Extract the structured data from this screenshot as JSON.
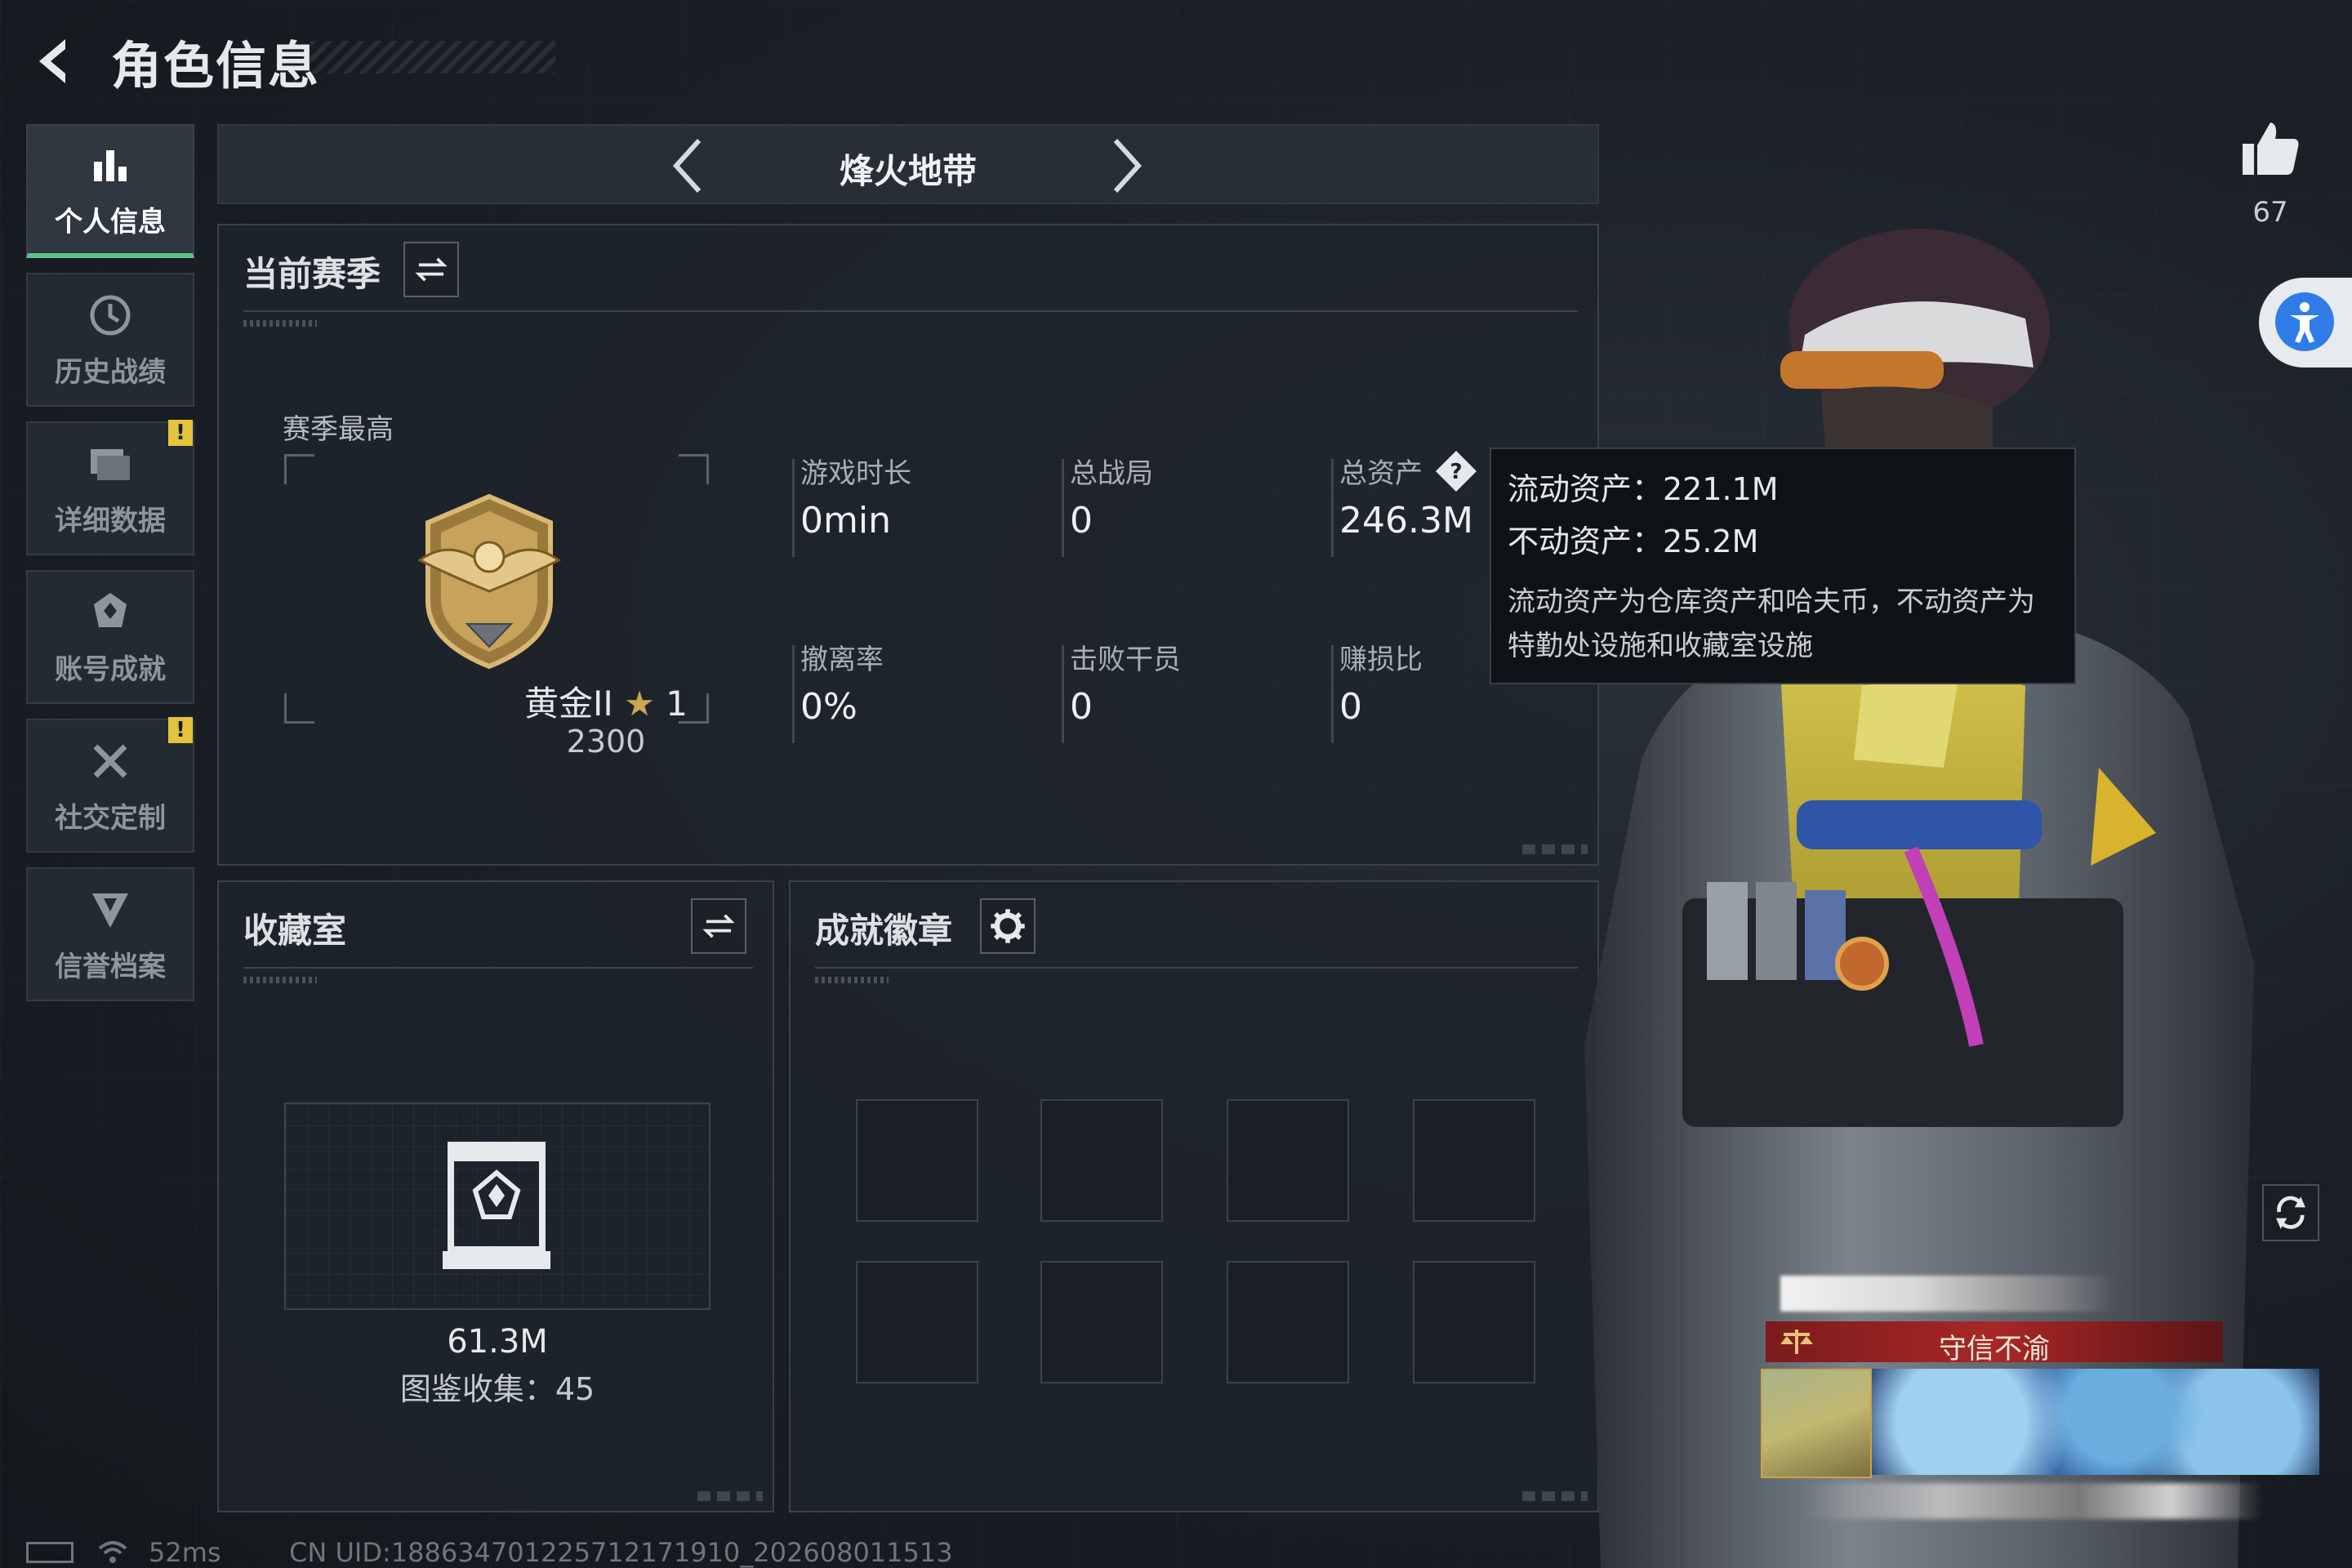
{
  "header": {
    "title": "角色信息"
  },
  "sidebar": {
    "items": [
      {
        "label": "个人信息",
        "icon": "bar-chart-icon",
        "active": true,
        "warning": ""
      },
      {
        "label": "历史战绩",
        "icon": "history-clock-icon",
        "active": false,
        "warning": ""
      },
      {
        "label": "详细数据",
        "icon": "folder-icon",
        "active": false,
        "warning": "!"
      },
      {
        "label": "账号成就",
        "icon": "achievement-icon",
        "active": false,
        "warning": ""
      },
      {
        "label": "社交定制",
        "icon": "tools-icon",
        "active": false,
        "warning": "!"
      },
      {
        "label": "信誉档案",
        "icon": "credit-shield-icon",
        "active": false,
        "warning": ""
      }
    ]
  },
  "mode": {
    "title": "烽火地带"
  },
  "season": {
    "title": "当前赛季",
    "best_label": "赛季最高",
    "rank_name": "黄金II",
    "rank_stars": "1",
    "rank_score": "2300",
    "stats": [
      {
        "label": "游戏时长",
        "value": "0min"
      },
      {
        "label": "总战局",
        "value": "0"
      },
      {
        "label": "总资产",
        "value": "246.3M"
      },
      {
        "label": "撤离率",
        "value": "0%"
      },
      {
        "label": "击败干员",
        "value": "0"
      },
      {
        "label": "赚损比",
        "value": "0"
      }
    ]
  },
  "tooltip": {
    "liquid": "流动资产：221.1M",
    "fixed": "不动资产：25.2M",
    "desc": "流动资产为仓库资产和哈夫币，不动资产为特勤处设施和收藏室设施"
  },
  "collection": {
    "title": "收藏室",
    "value": "61.3M",
    "count": "图鉴收集：45"
  },
  "badges": {
    "title": "成就徽章",
    "slots": 8
  },
  "likes": {
    "count": "67"
  },
  "profile": {
    "honor_title": "守信不渝"
  },
  "footer": {
    "ping": "52ms",
    "uid": "CN UID:18863470122571217191​0_202608011513"
  },
  "colors": {
    "active_accent": "#5fc28c",
    "warning": "#e3c43a",
    "honor_red": "#a82727",
    "accessibility_blue": "#2f7ce8"
  }
}
